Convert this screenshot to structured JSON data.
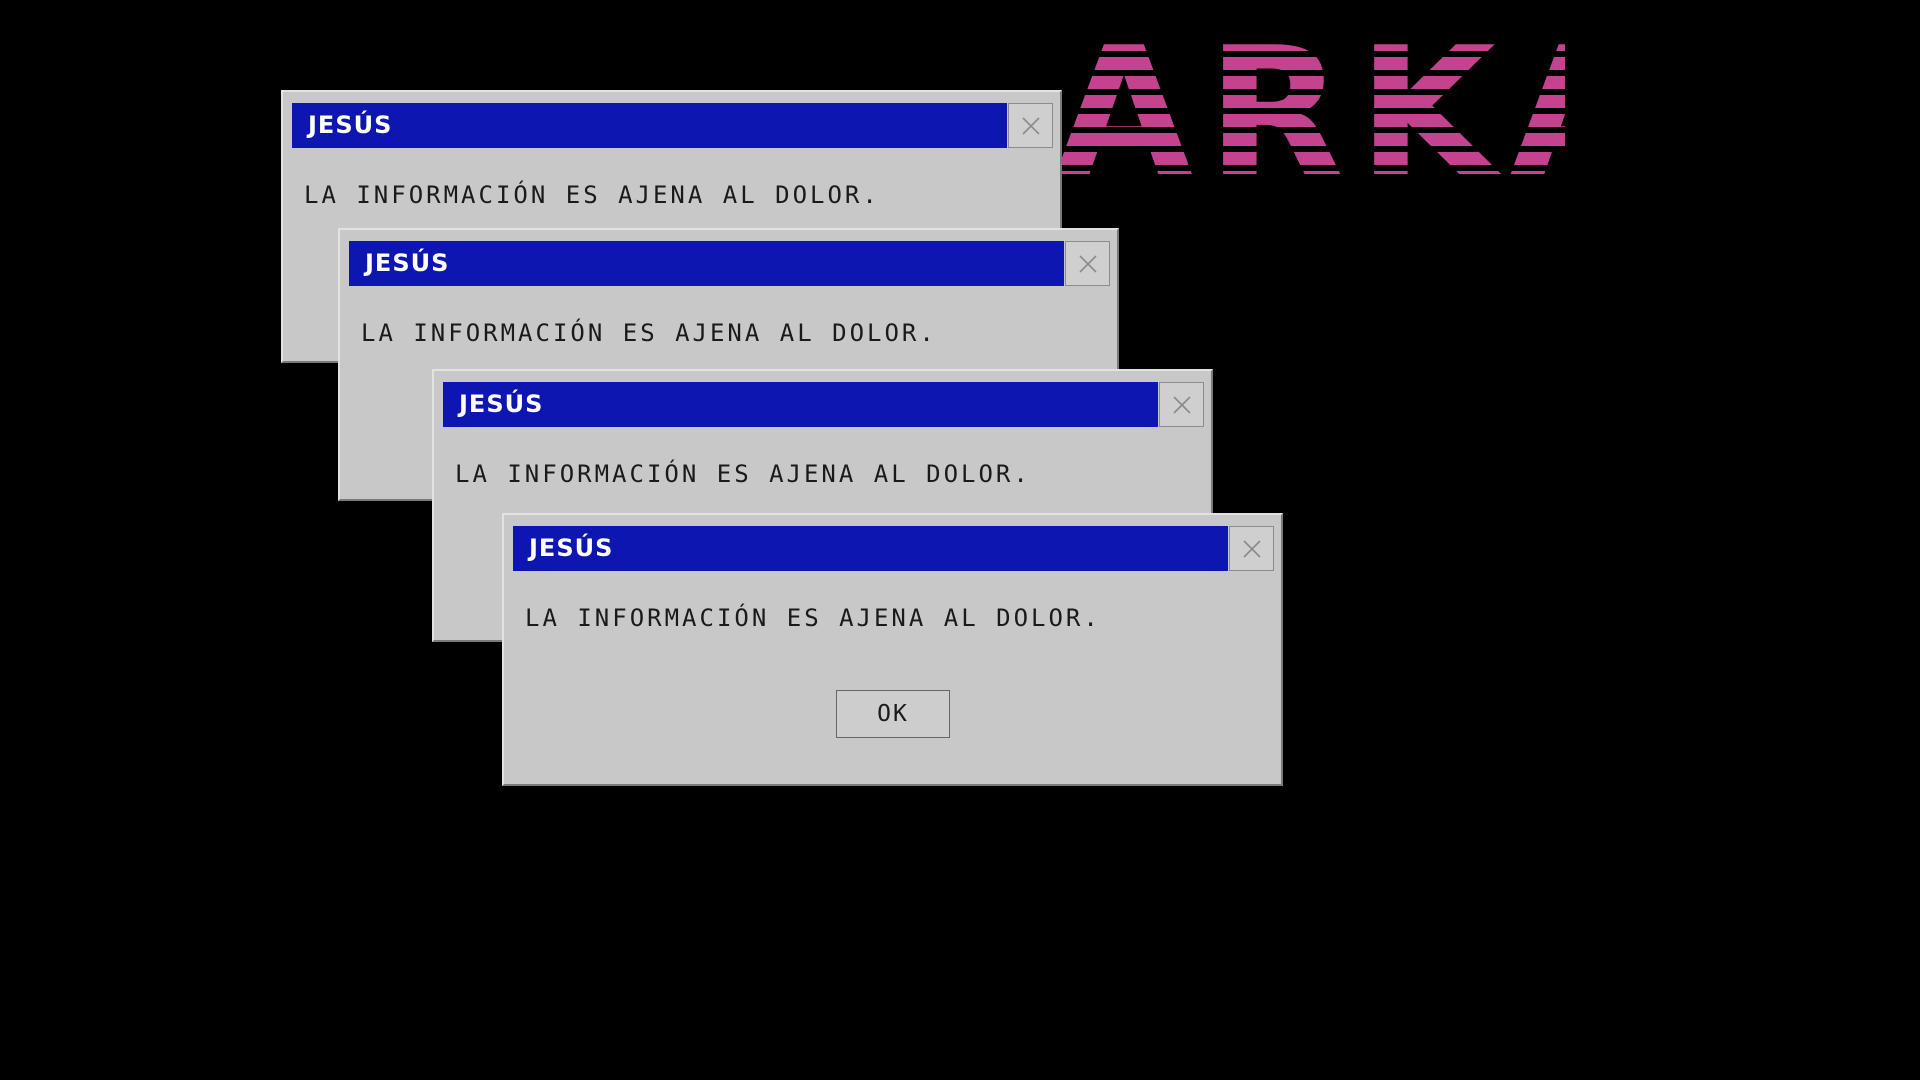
{
  "background_color": "#000000",
  "logo": {
    "text": "ARKA",
    "color": "#c4438f"
  },
  "dialogs": [
    {
      "title": "JESÚS",
      "message": "LA INFORMACIÓN ES AJENA AL DOLOR.",
      "close_icon": "close-icon"
    },
    {
      "title": "JESÚS",
      "message": "LA INFORMACIÓN ES AJENA AL DOLOR.",
      "close_icon": "close-icon"
    },
    {
      "title": "JESÚS",
      "message": "LA INFORMACIÓN ES AJENA AL DOLOR.",
      "close_icon": "close-icon"
    },
    {
      "title": "JESÚS",
      "message": "LA INFORMACIÓN ES AJENA AL DOLOR.",
      "close_icon": "close-icon",
      "ok_label": "OK"
    }
  ],
  "colors": {
    "titlebar": "#0d16b0",
    "dialog_face": "#c8c8c8",
    "text": "#1a1a1a"
  }
}
